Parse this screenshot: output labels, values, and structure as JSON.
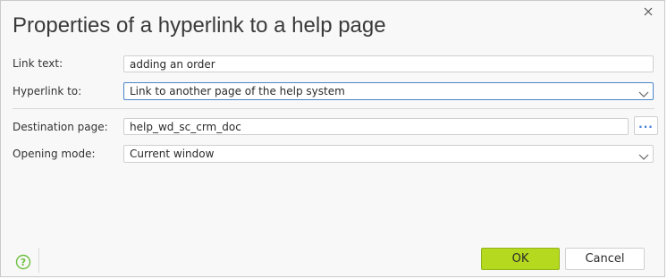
{
  "dialog": {
    "title": "Properties of a hyperlink to a help page",
    "close_icon": "close-icon"
  },
  "form": {
    "link_text_label": "Link text:",
    "link_text_value": "adding an order",
    "hyperlink_to_label": "Hyperlink to:",
    "hyperlink_to_value": "Link to another page of the help system",
    "destination_page_label": "Destination page:",
    "destination_page_value": "help_wd_sc_crm_doc",
    "browse_label": "...",
    "opening_mode_label": "Opening mode:",
    "opening_mode_value": "Current window"
  },
  "footer": {
    "help_icon": "help-icon",
    "ok_label": "OK",
    "cancel_label": "Cancel"
  },
  "colors": {
    "ok_button": "#b4d91e",
    "focus_border": "#4a86c8",
    "help_icon": "#6cbf3f",
    "browse_dots": "#3b7dd8"
  }
}
